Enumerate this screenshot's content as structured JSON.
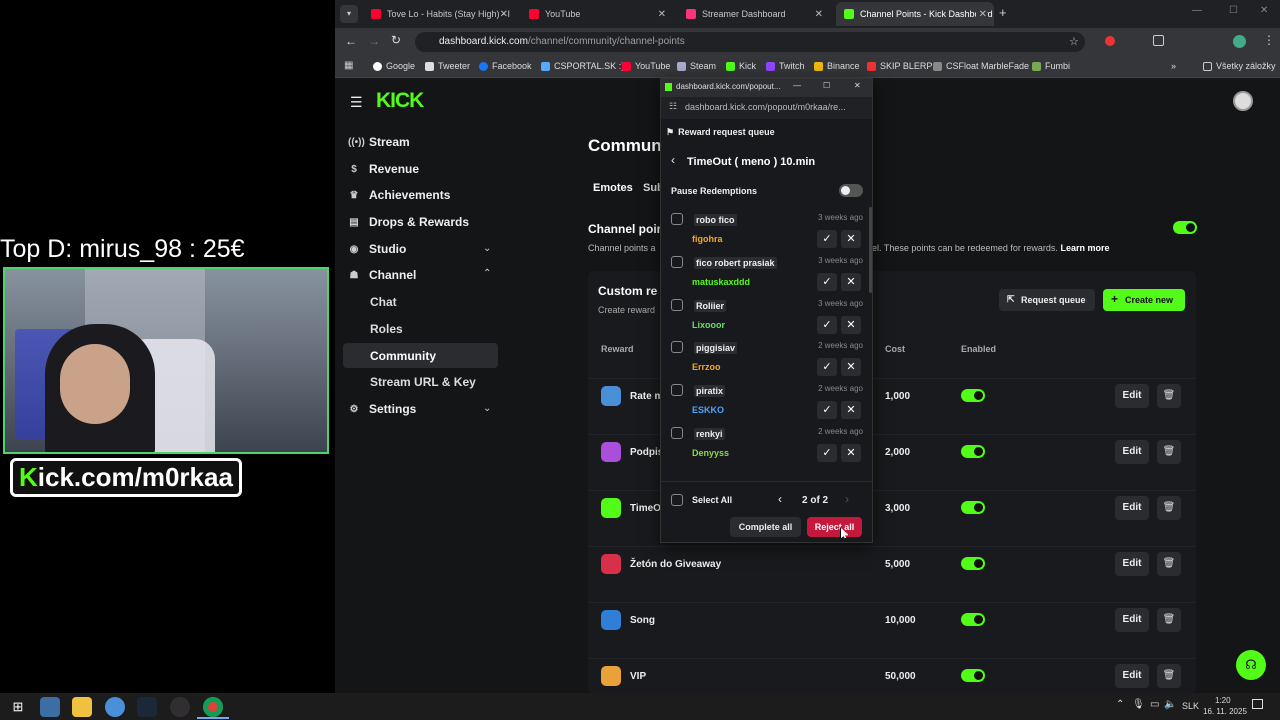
{
  "overlay": {
    "top_donation": "Top D: mirus_98 : 25€",
    "channel_k": "K",
    "channel_rest": "ick.com/m0rkaa"
  },
  "browser": {
    "tabs": [
      {
        "label": "Tove Lo - Habits (Stay High) - I",
        "color": "#ff0033"
      },
      {
        "label": "YouTube",
        "color": "#ff0033"
      },
      {
        "label": "Streamer Dashboard",
        "color": "#ff3377"
      },
      {
        "label": "Channel Points - Kick Dashboard",
        "color": "#53fc18"
      }
    ],
    "url_host": "dashboard.kick.com",
    "url_path": "/channel/community/channel-points",
    "bookmarks": [
      "Google",
      "Tweeter",
      "Facebook",
      "CSPORTAL.SK :)",
      "YouTube",
      "Steam",
      "Kick",
      "Twitch",
      "Binance",
      "SKIP BLERP",
      "CSFloat MarbleFade",
      "Fumbi"
    ],
    "bookmarks_all": "Všetky záložky"
  },
  "sidebar": {
    "logo": "KICK",
    "items": [
      {
        "label": "Stream",
        "icon": "broadcast-icon"
      },
      {
        "label": "Revenue",
        "icon": "dollar-icon"
      },
      {
        "label": "Achievements",
        "icon": "trophy-icon"
      },
      {
        "label": "Drops & Rewards",
        "icon": "gift-icon"
      },
      {
        "label": "Studio",
        "icon": "studio-icon"
      },
      {
        "label": "Channel",
        "icon": "users-icon"
      }
    ],
    "channel_sub": [
      "Chat",
      "Roles",
      "Community",
      "Stream URL & Key"
    ],
    "settings": "Settings"
  },
  "main": {
    "title": "Commun",
    "tabs": [
      "Emotes",
      "Sub"
    ],
    "channel_points_title": "Channel poin",
    "channel_points_desc_left": "Channel points a",
    "channel_points_desc_right": "el. These points can be redeemed for rewards.",
    "learn_more": "Learn more",
    "custom_rewards_title": "Custom re",
    "custom_rewards_desc": "Create reward",
    "request_queue": "Request queue",
    "create_new": "Create new",
    "col_reward": "Reward",
    "col_cost": "Cost",
    "col_enabled": "Enabled",
    "edit": "Edit",
    "rewards": [
      {
        "name": "Rate m",
        "cost": "1,000",
        "color": "#4a90d9"
      },
      {
        "name": "Podpis",
        "cost": "2,000",
        "color": "#a94fd9"
      },
      {
        "name": "TimeO",
        "cost": "3,000",
        "color": "#53fc18"
      },
      {
        "name": "Žetón do Giveaway",
        "cost": "5,000",
        "color": "#d9304a"
      },
      {
        "name": "Song",
        "cost": "10,000",
        "color": "#2f7fd9"
      },
      {
        "name": "VIP",
        "cost": "50,000",
        "color": "#e9a13a"
      }
    ]
  },
  "popup": {
    "window_title": "dashboard.kick.com/popout...",
    "url": "dashboard.kick.com/popout/m0rkaa/re...",
    "header": "Reward request queue",
    "reward_title": "TimeOut ( meno ) 10.min",
    "pause_label": "Pause Redemptions",
    "requests": [
      {
        "text": "robo fico",
        "user": "figohra",
        "time": "3 weeks ago",
        "color": "#f5a623"
      },
      {
        "text": "fico robert prasiak",
        "user": "matuskaxddd",
        "time": "3 weeks ago",
        "color": "#53fc18"
      },
      {
        "text": "Roliier",
        "user": "Lixooor",
        "time": "3 weeks ago",
        "color": "#6adf6a"
      },
      {
        "text": "piggisiav",
        "user": "Errzoo",
        "time": "2 weeks ago",
        "color": "#f5a623"
      },
      {
        "text": "piratix",
        "user": "ESKKO",
        "time": "2 weeks ago",
        "color": "#4aa3ff"
      },
      {
        "text": "renkyi",
        "user": "Denyyss",
        "time": "2 weeks ago",
        "color": "#8cd94a"
      }
    ],
    "select_all": "Select All",
    "pagination": "2 of 2",
    "complete_all": "Complete all",
    "reject_all": "Reject all"
  },
  "taskbar": {
    "language": "SLK",
    "time": "1:20",
    "date": "16. 11. 2025"
  }
}
